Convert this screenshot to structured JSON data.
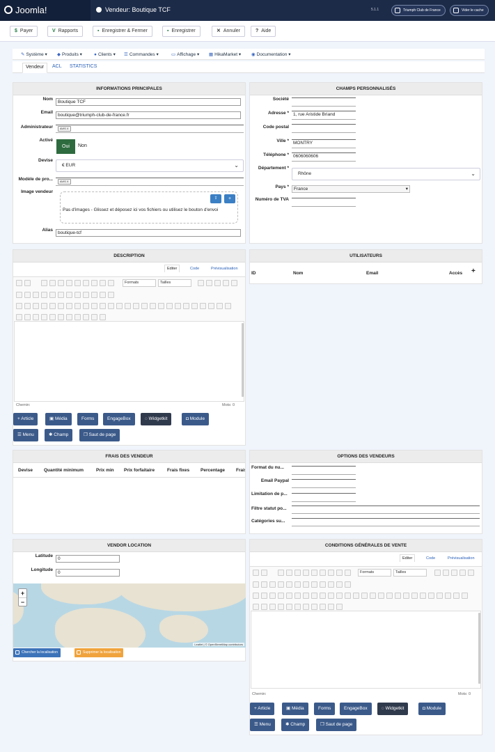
{
  "header": {
    "logo": "Joomla!",
    "title": "Vendeur: Boutique TCF",
    "version": "5.1.1",
    "site_button": "Triumph Club de France",
    "cache_button": "Vider le cache"
  },
  "toolbar": {
    "pay": "Payer",
    "reports": "Rapports",
    "save_close": "Enregistrer & Fermer",
    "save": "Enregistrer",
    "cancel": "Annuler",
    "help": "Aide"
  },
  "hikanav": [
    "Système",
    "Produits",
    "Clients",
    "Commandes",
    "Affichage",
    "HikaMarket",
    "Documentation"
  ],
  "vtabs": [
    "Vendeur",
    "ACL",
    "STATISTICS"
  ],
  "main_info": {
    "title": "INFORMATIONS PRINCIPALES",
    "name_label": "Nom",
    "name": "Boutique TCF",
    "email_label": "Email",
    "email": "boutique@triumph-club-de-france.fr",
    "admin_label": "Administrateur",
    "admin_tag": "AVIS X",
    "active_label": "Activé",
    "yes": "Oui",
    "no": "Non",
    "currency_label": "Devise",
    "currency": "€ EUR",
    "model_label": "Modèle de pro...",
    "model_tag": "AVIS X",
    "image_label": "Image vendeur",
    "dropzone": "Pas d'images - Glissez et déposez ici vos fichiers ou utilisez le bouton d'envoi",
    "alias_label": "Alias",
    "alias": "boutique-tcf"
  },
  "custom_fields": {
    "title": "CHAMPS PERSONNALISÉS",
    "company_label": "Société",
    "address_label": "Adresse *",
    "address": "1, rue Aristide Briand",
    "postal_label": "Code postal",
    "city_label": "Ville *",
    "city": "MONTRY",
    "phone_label": "Téléphone *",
    "phone": "0606060606",
    "dept_label": "Département *",
    "dept": "Rhône",
    "country_label": "Pays *",
    "country": "France",
    "vat_label": "Numéro de TVA"
  },
  "description": {
    "title": "DESCRIPTION",
    "tabs": [
      "Editer",
      "Code",
      "Prévisualisation"
    ],
    "formats": "Formats",
    "sizes": "Tailles",
    "path": "Chemin:",
    "words": "Mots: 0",
    "buttons": [
      "Article",
      "Média",
      "Forms",
      "EngageBox",
      "Widgetkit",
      "Module",
      "Menu",
      "Champ",
      "Saut de page"
    ]
  },
  "users": {
    "title": "UTILISATEURS",
    "cols": [
      "ID",
      "Nom",
      "Email",
      "Accès"
    ]
  },
  "fees": {
    "title": "FRAIS DES VENDEUR",
    "cols": [
      "Devise",
      "Quantité minimum",
      "Prix min",
      "Prix forfaitaire",
      "Frais fixes",
      "Percentage",
      "Frais"
    ]
  },
  "vendor_options": {
    "title": "OPTIONS DES VENDEURS",
    "labels": [
      "Format du nu...",
      "Email Paypal",
      "Limitation de p...",
      "Filtre statut po...",
      "Catégories su..."
    ]
  },
  "location": {
    "title": "VENDOR LOCATION",
    "lat_label": "Latitude",
    "lat": "0",
    "lng_label": "Longitude",
    "lng": "0",
    "zoom_in": "+",
    "zoom_out": "−",
    "attribution": "Leaflet | © OpenStreetMap contributors",
    "find": "Chercher la localisation",
    "remove": "Supprimer la localisation"
  },
  "cgv": {
    "title": "CONDITIONS GÉNÉRALES DE VENTE",
    "tabs": [
      "Editer",
      "Code",
      "Prévisualisation"
    ],
    "formats": "Formats",
    "sizes": "Tailles",
    "path": "Chemin:",
    "words": "Mots: 0",
    "buttons": [
      "Article",
      "Média",
      "Forms",
      "EngageBox",
      "Widgetkit",
      "Module",
      "Menu",
      "Champ",
      "Saut de page"
    ]
  },
  "colors": {
    "topbar": "#1c2b48",
    "button": "#3b5a8a",
    "button_dark": "#303a4d",
    "active_green": "#2e6b3f",
    "warning": "#f0a33c"
  }
}
